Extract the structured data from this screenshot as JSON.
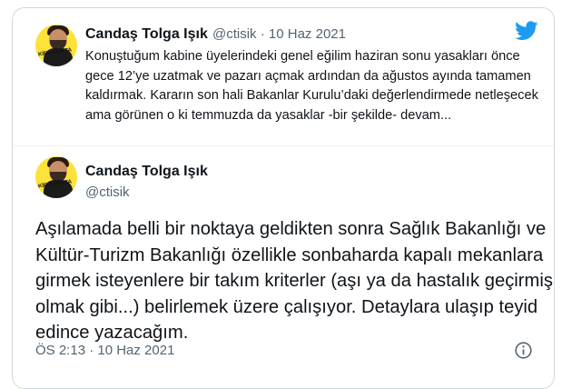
{
  "quoted_tweet": {
    "author_name": "Candaş Tolga Işık",
    "handle": "@ctisik",
    "separator": "·",
    "date": "10 Haz 2021",
    "text": "Konuştuğum kabine üyelerindeki genel eğilim haziran sonu yasakları önce gece 12’ye uzatmak ve pazarı açmak ardından da ağustos ayında tamamen kaldırmak. Kararın son hali Bakanlar Kurulu’daki değerlendirmede netleşecek ama görünen o ki temmuzda da yasaklar -bir şekilde- devam...",
    "avatar_text": "KİRLİ HAFTA"
  },
  "main_tweet": {
    "author_name": "Candaş Tolga Işık",
    "handle": "@ctisik",
    "text": "Aşılamada belli bir noktaya geldikten sonra Sağlık Bakanlığı ve Kültür-Turizm Bakanlığı özellikle sonbaharda kapalı mekanlara girmek isteyenlere bir takım kriterler (aşı ya da hastalık geçirmiş olmak gibi...) belirlemek üzere çalışıyor. Detaylara ulaşıp teyid edince yazacağım.",
    "timestamp": "ÖS 2:13 · 10 Haz 2021",
    "avatar_text": "KİRLİ HAFTA"
  },
  "icons": {
    "brand": "twitter-bird-icon",
    "info": "info-icon"
  },
  "colors": {
    "brand_blue": "#1d9bf0",
    "muted": "#536471",
    "text": "#0f1419",
    "border": "#cfd9de",
    "avatar_bg": "#fde23a"
  }
}
